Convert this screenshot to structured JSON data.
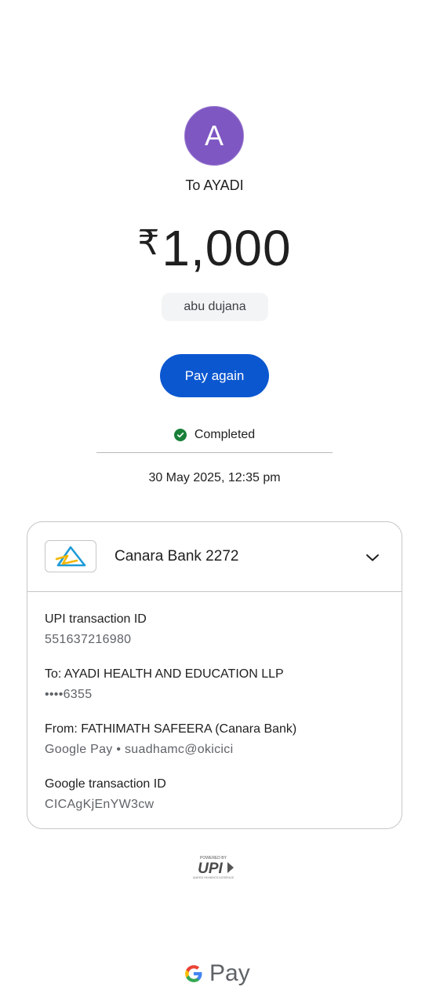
{
  "recipient": {
    "avatar_letter": "A",
    "avatar_color": "#7e57c2",
    "to_label": "To AYADI"
  },
  "payment": {
    "currency_symbol": "₹",
    "amount": "1,000",
    "note": "abu dujana",
    "pay_again_label": "Pay again",
    "button_color": "#0b57d0"
  },
  "status": {
    "text": "Completed",
    "icon": "check-circle-icon",
    "color": "#188038",
    "datetime": "30 May 2025, 12:35 pm"
  },
  "account_card": {
    "bank_name": "Canara Bank 2272",
    "bank_logo": "canara-bank-logo",
    "expand_icon": "chevron-down-icon",
    "details": [
      {
        "label": "UPI transaction ID",
        "value": "551637216980"
      },
      {
        "label": "To: AYADI HEALTH AND EDUCATION LLP",
        "value": "••••6355"
      },
      {
        "label": "From: FATHIMATH  SAFEERA (Canara Bank)",
        "value": "Google Pay • suadhamc@okicici"
      },
      {
        "label": "Google transaction ID",
        "value": "CICAgKjEnYW3cw"
      }
    ]
  },
  "footer": {
    "upi_powered_by": "POWERED BY",
    "upi_wordmark": "UPI",
    "upi_tagline": "UNIFIED PAYMENTS INTERFACE",
    "gpay_label": "Pay"
  }
}
